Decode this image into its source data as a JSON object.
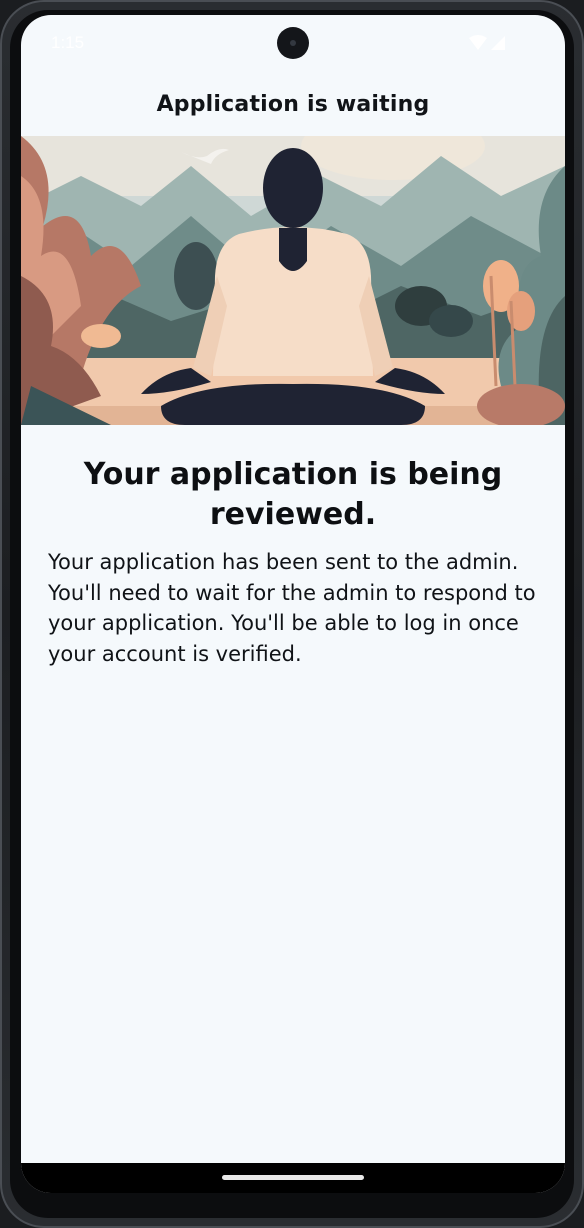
{
  "status_bar": {
    "time": "1:15",
    "icons": [
      "wifi-icon",
      "cell-signal-icon"
    ]
  },
  "app_bar": {
    "title": "Application is waiting"
  },
  "hero": {
    "illustration": "meditation-illustration"
  },
  "content": {
    "heading": "Your application is being reviewed.",
    "body": "Your application has been sent to the admin. You'll need to wait for the admin to respond to your application. You'll be able to log in once your account is verified."
  },
  "colors": {
    "background": "#f5f9fc",
    "text": "#0d0f12",
    "nav_bar": "#000000"
  }
}
